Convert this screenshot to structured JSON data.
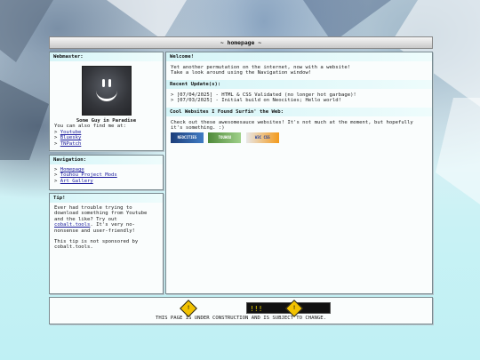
{
  "page": {
    "title": "~ homepage ~"
  },
  "webmaster": {
    "heading": "Webmaster:",
    "name": "Some Guy in Paradise",
    "find_me": "You can also find me at:",
    "links": [
      "Youtube",
      "Bluesky",
      "TNPatch"
    ]
  },
  "navigation": {
    "heading": "Navigation:",
    "links": [
      "Homepage",
      "Touhou Project Mods",
      "Art Gallery"
    ]
  },
  "tip": {
    "heading": "Tip!",
    "text_before": "Ever had trouble trying to download something from Youtube and the like? Try out ",
    "link": "cobalt.tools",
    "text_after": ". It's very no-nonsense and user-friendly!",
    "note": "This tip is not sponsored by cobalt.tools."
  },
  "welcome": {
    "heading": "Welcome!",
    "line1": "Yet another permutation on the internet, now with a website!",
    "line2": "Take a look around using the Navigation window!"
  },
  "updates": {
    "heading": "Recent Update(s):",
    "items": [
      "> [07/04/2025] - HTML & CSS Validated (no longer hot garbage)!",
      "> [07/03/2025] - Initial build on Neocities; Hello world!"
    ]
  },
  "cool_sites": {
    "heading": "Cool Websites I Found Surfin' the Web:",
    "text": "Check out these awesomesauce websites! It's not much at the moment, but hopefully it's something. :)",
    "buttons": [
      "NEOCITIES",
      "TOUHOU",
      "W3C CSS"
    ]
  },
  "footer": {
    "ticker": "!!!",
    "sign_glyph": "!",
    "notice": "THIS PAGE IS UNDER CONSTRUCTION AND IS SUBJECT TO CHANGE."
  }
}
